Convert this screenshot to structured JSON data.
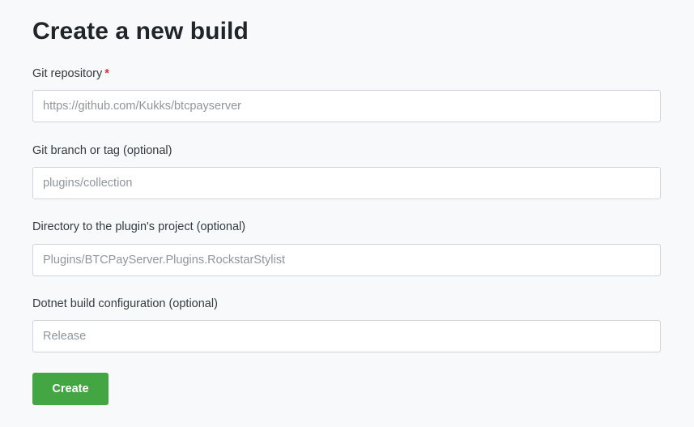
{
  "page": {
    "title": "Create a new build"
  },
  "form": {
    "repository": {
      "label": "Git repository",
      "required_marker": "*",
      "value": "",
      "placeholder": "https://github.com/Kukks/btcpayserver"
    },
    "branch": {
      "label": "Git branch or tag (optional)",
      "value": "",
      "placeholder": "plugins/collection"
    },
    "directory": {
      "label": "Directory to the plugin's project (optional)",
      "value": "",
      "placeholder": "Plugins/BTCPayServer.Plugins.RockstarStylist"
    },
    "configuration": {
      "label": "Dotnet build configuration (optional)",
      "value": "",
      "placeholder": "Release"
    },
    "submit_label": "Create"
  },
  "colors": {
    "background": "#f8f9fa",
    "primary_button": "#44a543",
    "required_marker": "#d9313a"
  }
}
